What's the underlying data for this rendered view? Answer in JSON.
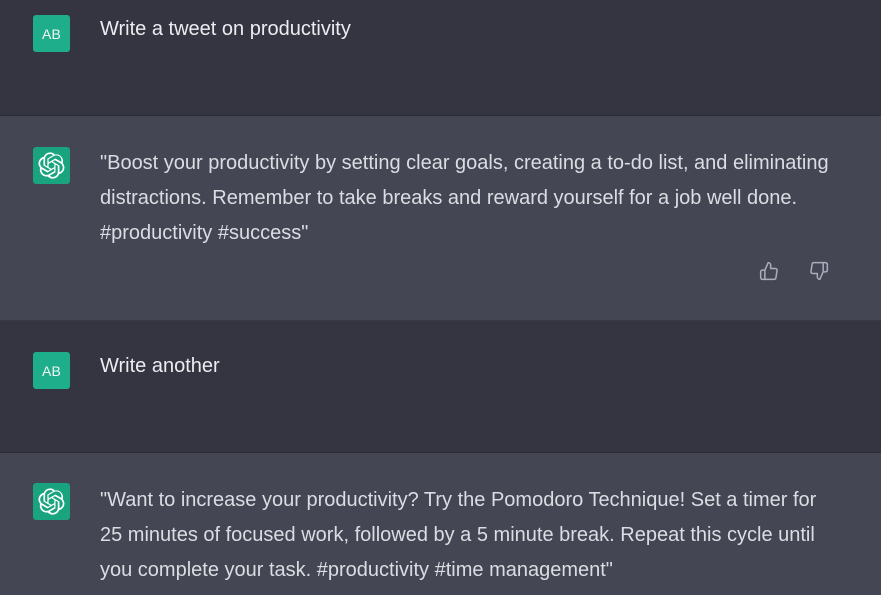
{
  "conversation": {
    "messages": [
      {
        "role": "user",
        "avatar_initials": "AB",
        "text": "Write a tweet on productivity"
      },
      {
        "role": "assistant",
        "avatar_icon": "openai-logo-icon",
        "text": "\"Boost your productivity by setting clear goals, creating a to-do list, and eliminating distractions. Remember to take breaks and reward yourself for a job well done. #productivity #success\"",
        "feedback": [
          "thumbs-up-icon",
          "thumbs-down-icon"
        ]
      },
      {
        "role": "user",
        "avatar_initials": "AB",
        "text": "Write another"
      },
      {
        "role": "assistant",
        "avatar_icon": "openai-logo-icon",
        "text": "\"Want to increase your productivity? Try the Pomodoro Technique! Set a timer for 25 minutes of focused work, followed by a 5 minute break. Repeat this cycle until you complete your task. #productivity #time management\""
      }
    ]
  },
  "colors": {
    "user_bg": "#343541",
    "assistant_bg": "#444654",
    "user_avatar_bg": "#1fae8b",
    "bot_avatar_bg": "#19a37f",
    "text": "#ececf1",
    "icon": "#acacbe"
  }
}
